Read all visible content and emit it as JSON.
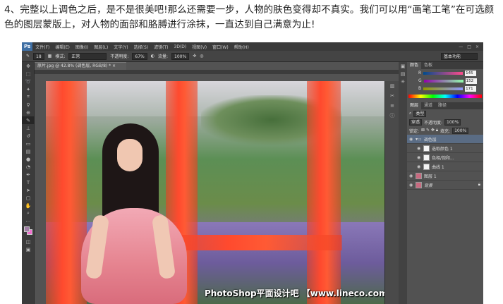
{
  "caption": "4、完整以上调色之后，是不是很美吧!那么还需要一步，人物的肤色变得却不真实。我们可以用“画笔工笔”在可选颜色的图层蒙版上，对人物的面部和胳膊进行涂抹，一直达到自己满意为止!",
  "app": {
    "logo": "Ps",
    "menu": [
      "文件(F)",
      "编辑(E)",
      "图像(I)",
      "图层(L)",
      "文字(Y)",
      "选择(S)",
      "滤镜(T)",
      "3D(D)",
      "视图(V)",
      "窗口(W)",
      "帮助(H)"
    ],
    "window_controls": [
      "—",
      "□",
      "×"
    ]
  },
  "options_bar": {
    "brush_size": "18",
    "mode_label": "模式:",
    "mode_value": "正常",
    "opacity_label": "不透明度:",
    "opacity_value": "67%",
    "flow_label": "流量:",
    "flow_value": "100%",
    "preset": "基本功能"
  },
  "document": {
    "tab": "原片.jpg @ 42.8% (调色层, RGB/8) * ×",
    "watermark": "PhotoShop平面设计吧 【www.lineco.com/tieba/1783】"
  },
  "tools": [
    "move",
    "marquee",
    "lasso",
    "quick-select",
    "crop",
    "eyedropper",
    "healing",
    "brush",
    "clone",
    "history-brush",
    "eraser",
    "gradient",
    "blur",
    "dodge",
    "pen",
    "type",
    "path-select",
    "shape",
    "hand",
    "zoom"
  ],
  "color_panel": {
    "tabs": [
      "颜色",
      "色板"
    ],
    "channels": [
      {
        "label": "R",
        "value": "145",
        "gradient": "linear-gradient(90deg,#004b8c,#ff4b8c)"
      },
      {
        "label": "G",
        "value": "152",
        "gradient": "linear-gradient(90deg,#9100ab,#91ffab)"
      },
      {
        "label": "B",
        "value": "171",
        "gradient": "linear-gradient(90deg,#919800,#9198ff)"
      }
    ]
  },
  "layers_panel": {
    "tabs": [
      "图层",
      "通道",
      "路径"
    ],
    "filter": "类型",
    "blend": "穿透",
    "opacity_label": "不透明度:",
    "opacity_value": "100%",
    "lock_label": "锁定:",
    "fill_label": "填充:",
    "fill_value": "100%",
    "layers": [
      {
        "name": "调色层",
        "selected": true,
        "thumb": "#6a6a6a"
      },
      {
        "name": "选取颜色 1",
        "selected": false,
        "thumb": "#f4f4f4"
      },
      {
        "name": "色相/饱和...",
        "selected": false,
        "thumb": "#f4f4f4"
      },
      {
        "name": "曲线 1",
        "selected": false,
        "thumb": "#f4f4f4"
      },
      {
        "name": "图层 1",
        "selected": false,
        "thumb": "#c86a80"
      },
      {
        "name": "背景",
        "selected": false,
        "thumb": "#c86a80"
      }
    ]
  },
  "colors": {
    "foreground": "#a07ea5",
    "background": "#f36fd0",
    "post_red": "#ff4a2e"
  }
}
